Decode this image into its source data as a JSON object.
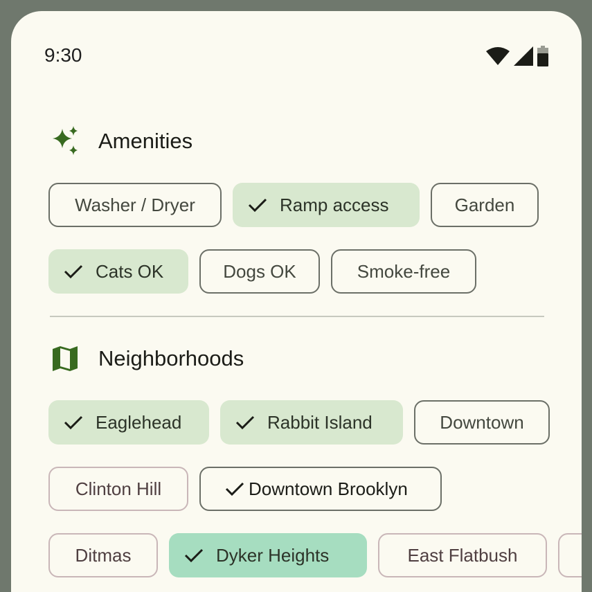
{
  "status_bar": {
    "time": "9:30",
    "icons": [
      "wifi-icon",
      "signal-icon",
      "battery-icon"
    ]
  },
  "amenities": {
    "title": "Amenities",
    "icon": "sparkle-icon",
    "chips": [
      {
        "label": "Washer / Dryer",
        "selected": false
      },
      {
        "label": "Ramp access",
        "selected": true
      },
      {
        "label": "Garden",
        "selected": false
      },
      {
        "label": "Cats OK",
        "selected": true
      },
      {
        "label": "Dogs OK",
        "selected": false
      },
      {
        "label": "Smoke-free",
        "selected": false
      }
    ]
  },
  "neighborhoods": {
    "title": "Neighborhoods",
    "icon": "map-icon",
    "chips": [
      {
        "label": "Eaglehead",
        "selected": true
      },
      {
        "label": "Rabbit Island",
        "selected": true
      },
      {
        "label": "Downtown",
        "selected": false
      },
      {
        "label": "Clinton Hill",
        "selected": false
      },
      {
        "label": "Downtown Brooklyn",
        "selected": true
      },
      {
        "label": "Ditmas",
        "selected": false
      },
      {
        "label": "Dyker Heights",
        "selected": true
      },
      {
        "label": "East Flatbush",
        "selected": false
      }
    ]
  },
  "colors": {
    "accent_green": "#386a20",
    "selected_chip": "#d8e8cf",
    "selected_chip_teal": "#a6ddc0",
    "background": "#fbfaf1",
    "frame": "#6f786d"
  }
}
